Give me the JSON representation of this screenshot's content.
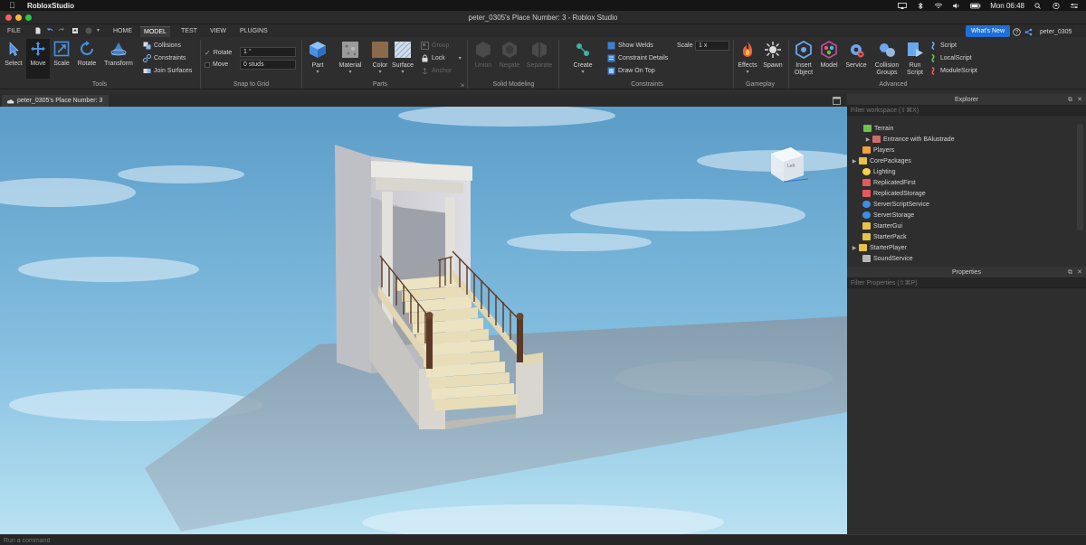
{
  "mac_menu": {
    "app_name": "RobloxStudio",
    "clock": "Mon 06:48"
  },
  "window": {
    "title": "peter_0305's Place Number: 3 - Roblox Studio"
  },
  "menu_tabs": [
    "FILE",
    "HOME",
    "MODEL",
    "TEST",
    "VIEW",
    "PLUGINS"
  ],
  "active_tab": "MODEL",
  "whats_new": "What's New",
  "username": "peter_0305",
  "ribbon": {
    "tools": {
      "label": "Tools",
      "buttons": [
        "Select",
        "Move",
        "Scale",
        "Rotate",
        "Transform"
      ],
      "options": [
        "Collisions",
        "Constraints",
        "Join Surfaces"
      ]
    },
    "snap": {
      "label": "Snap to Grid",
      "rotate_label": "Rotate",
      "rotate_value": "1 °",
      "move_label": "Move",
      "move_value": "0 studs"
    },
    "parts": {
      "label": "Parts",
      "buttons": [
        "Part",
        "Material",
        "Color",
        "Surface"
      ],
      "options": [
        "Group",
        "Lock",
        "Anchor"
      ]
    },
    "solid": {
      "label": "Solid Modeling",
      "buttons": [
        "Union",
        "Negate",
        "Separate"
      ]
    },
    "constraints": {
      "label": "Constraints",
      "create": "Create",
      "options": [
        "Show Welds",
        "Constraint Details",
        "Draw On Top"
      ],
      "scale_label": "Scale",
      "scale_value": "1 x"
    },
    "gameplay": {
      "label": "Gameplay",
      "buttons": [
        "Effects",
        "Spawn"
      ]
    },
    "advanced": {
      "label": "Advanced",
      "buttons": [
        "Insert Object",
        "Model",
        "Service",
        "Collision Groups",
        "Run Script"
      ],
      "scripts": [
        "Script",
        "LocalScript",
        "ModuleScript"
      ]
    }
  },
  "doc_tab": "peter_0305's Place Number: 3",
  "viewport": {
    "view_cube_face": "Left"
  },
  "explorer": {
    "title": "Explorer",
    "filter_placeholder": "Filter workspace (⇧⌘X)",
    "items": [
      {
        "label": "Terrain",
        "icon": "terrain-icon",
        "color": "#6cc24a"
      },
      {
        "label": "Entrance with BAlustrade",
        "icon": "model-icon",
        "color": "#d06a6a"
      },
      {
        "label": "Players",
        "icon": "players-icon",
        "color": "#f0a23a"
      },
      {
        "label": "CorePackages",
        "icon": "folder-icon",
        "color": "#e8c14a"
      },
      {
        "label": "Lighting",
        "icon": "lightbulb-icon",
        "color": "#f2d34a"
      },
      {
        "label": "ReplicatedFirst",
        "icon": "replicated-icon",
        "color": "#e45a5a"
      },
      {
        "label": "ReplicatedStorage",
        "icon": "replicated-storage-icon",
        "color": "#e45a5a"
      },
      {
        "label": "ServerScriptService",
        "icon": "server-script-icon",
        "color": "#3d8ee6"
      },
      {
        "label": "ServerStorage",
        "icon": "server-storage-icon",
        "color": "#3d8ee6"
      },
      {
        "label": "StarterGui",
        "icon": "folder-icon",
        "color": "#e8c14a"
      },
      {
        "label": "StarterPack",
        "icon": "folder-icon",
        "color": "#e8c14a"
      },
      {
        "label": "StarterPlayer",
        "icon": "folder-icon",
        "color": "#e8c14a"
      },
      {
        "label": "SoundService",
        "icon": "sound-icon",
        "color": "#b8b8b8"
      }
    ]
  },
  "properties": {
    "title": "Properties",
    "filter_placeholder": "Filter Properties (⇧⌘P)"
  },
  "command_bar": {
    "placeholder": "Run a command"
  },
  "colors": {
    "accent": "#1f6fd6",
    "sky_top": "#5c9cc9",
    "sky_bottom": "#a9d6ea",
    "baseplate": "#8a9aa8"
  }
}
